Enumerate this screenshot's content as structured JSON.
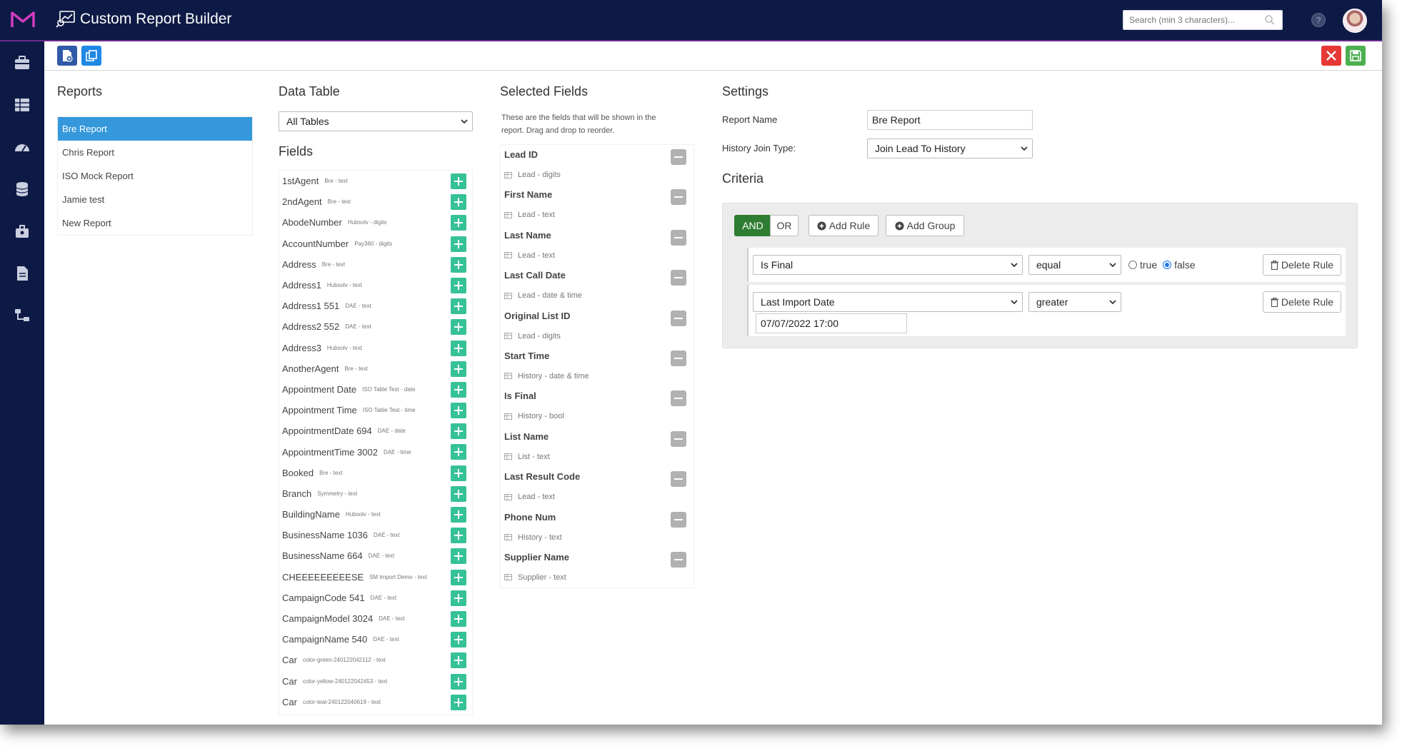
{
  "header": {
    "app_title": "Custom Report Builder",
    "search_placeholder": "Search (min 3 characters)..."
  },
  "colors": {
    "topbar": "#0d1a45",
    "accent_purple": "#6a2c8a",
    "active_blue": "#3598db",
    "add_green": "#36c197",
    "and_green": "#2e7d32",
    "delete_red": "#e53935",
    "save_green": "#4caf50"
  },
  "sidebar": {
    "icons": [
      "briefcase-icon",
      "grid-icon",
      "dashboard-icon",
      "database-icon",
      "tools-icon",
      "document-icon",
      "sitemap-icon"
    ]
  },
  "toolbar": {
    "new_report": "new-report-icon",
    "copy_report": "copy-icon",
    "close": "close-icon",
    "save": "save-icon"
  },
  "reports": {
    "title": "Reports",
    "items": [
      {
        "label": "Bre Report",
        "active": true
      },
      {
        "label": "Chris Report"
      },
      {
        "label": "ISO Mock Report"
      },
      {
        "label": "Jamie test"
      },
      {
        "label": "New Report"
      }
    ]
  },
  "data_table": {
    "title": "Data Table",
    "selected": "All Tables"
  },
  "fields": {
    "title": "Fields",
    "items": [
      {
        "name": "1stAgent",
        "meta": "Bre - text"
      },
      {
        "name": "2ndAgent",
        "meta": "Bre - text"
      },
      {
        "name": "AbodeNumber",
        "meta": "Hubsolv - digits"
      },
      {
        "name": "AccountNumber",
        "meta": "Pay360 - digits"
      },
      {
        "name": "Address",
        "meta": "Bre - text"
      },
      {
        "name": "Address1",
        "meta": "Hubsolv - text"
      },
      {
        "name": "Address1 551",
        "meta": "DAE - text"
      },
      {
        "name": "Address2 552",
        "meta": "DAE - text"
      },
      {
        "name": "Address3",
        "meta": "Hubsolv - text"
      },
      {
        "name": "AnotherAgent",
        "meta": "Bre - text"
      },
      {
        "name": "Appointment Date",
        "meta": "ISO Table Test - date"
      },
      {
        "name": "Appointment Time",
        "meta": "ISO Table Test - time"
      },
      {
        "name": "AppointmentDate 694",
        "meta": "DAE - date"
      },
      {
        "name": "AppointmentTime 3002",
        "meta": "DAE - time"
      },
      {
        "name": "Booked",
        "meta": "Bre - text"
      },
      {
        "name": "Branch",
        "meta": "Symmetry - text"
      },
      {
        "name": "BuildingName",
        "meta": "Hubsolv - text"
      },
      {
        "name": "BusinessName 1036",
        "meta": "DAE - text"
      },
      {
        "name": "BusinessName 664",
        "meta": "DAE - text"
      },
      {
        "name": "CHEEEEEEEEESE",
        "meta": "SM Import Demo - text"
      },
      {
        "name": "CampaignCode 541",
        "meta": "DAE - text"
      },
      {
        "name": "CampaignModel 3024",
        "meta": "DAE - text"
      },
      {
        "name": "CampaignName 540",
        "meta": "DAE - text"
      },
      {
        "name": "Car",
        "meta": "color-green-240122042112 - text"
      },
      {
        "name": "Car",
        "meta": "color-yellow-240122042453 - text"
      },
      {
        "name": "Car",
        "meta": "color-teal-240122040619 - text"
      }
    ]
  },
  "selected_fields": {
    "title": "Selected Fields",
    "description": "These are the fields that will be shown in the report. Drag and drop to reorder.",
    "items": [
      {
        "name": "Lead ID",
        "meta": "Lead - digits"
      },
      {
        "name": "First Name",
        "meta": "Lead - text"
      },
      {
        "name": "Last Name",
        "meta": "Lead - text"
      },
      {
        "name": "Last Call Date",
        "meta": "Lead - date & time"
      },
      {
        "name": "Original List ID",
        "meta": "Lead - digits"
      },
      {
        "name": "Start Time",
        "meta": "History - date & time"
      },
      {
        "name": "Is Final",
        "meta": "History - bool"
      },
      {
        "name": "List Name",
        "meta": "List - text"
      },
      {
        "name": "Last Result Code",
        "meta": "Lead - text"
      },
      {
        "name": "Phone Num",
        "meta": "History - text"
      },
      {
        "name": "Supplier Name",
        "meta": "Supplier - text"
      }
    ]
  },
  "settings": {
    "title": "Settings",
    "report_name_label": "Report Name",
    "report_name_value": "Bre Report",
    "history_join_label": "History Join Type:",
    "history_join_value": "Join Lead To History"
  },
  "criteria": {
    "title": "Criteria",
    "and_label": "AND",
    "or_label": "OR",
    "add_rule_label": "Add Rule",
    "add_group_label": "Add Group",
    "rules": [
      {
        "field": "Is Final",
        "operator": "equal",
        "true_label": "true",
        "false_label": "false",
        "delete_label": "Delete Rule"
      },
      {
        "field": "Last Import Date",
        "operator": "greater",
        "value": "07/07/2022 17:00",
        "delete_label": "Delete Rule"
      }
    ]
  }
}
